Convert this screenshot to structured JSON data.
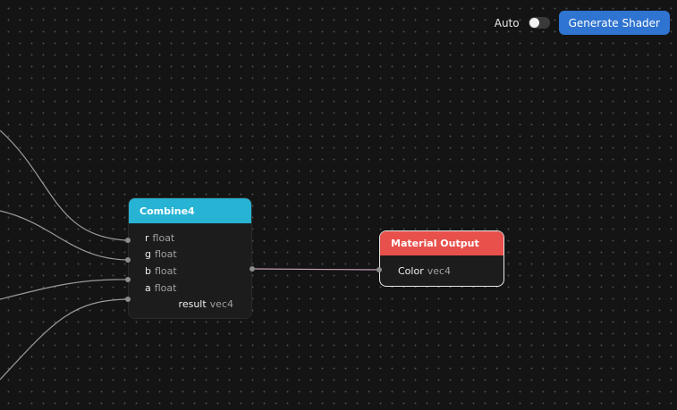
{
  "toolbar": {
    "auto_label": "Auto",
    "auto_enabled": false,
    "generate_label": "Generate Shader"
  },
  "nodes": {
    "combine4": {
      "title": "Combine4",
      "header_color": "#27b3d3",
      "inputs": [
        {
          "name": "r",
          "type": "float"
        },
        {
          "name": "g",
          "type": "float"
        },
        {
          "name": "b",
          "type": "float"
        },
        {
          "name": "a",
          "type": "float"
        }
      ],
      "output": {
        "name": "result",
        "type": "vec4"
      }
    },
    "material_output": {
      "title": "Material Output",
      "header_color": "#e8504b",
      "inputs": [
        {
          "name": "Color",
          "type": "vec4"
        }
      ]
    }
  },
  "colors": {
    "canvas_bg": "#141414",
    "wire": "#9a9a9a",
    "active_wire": "#c9a0b8",
    "button": "#2f74d0"
  }
}
